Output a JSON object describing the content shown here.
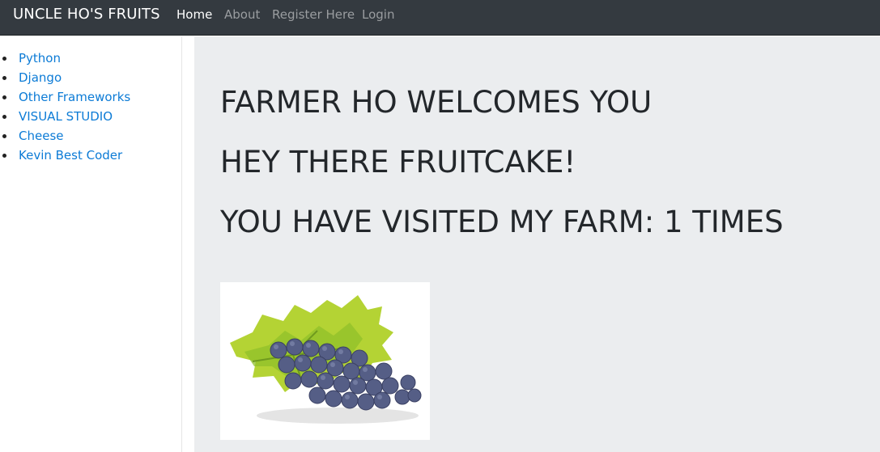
{
  "navbar": {
    "brand": "UNCLE HO'S FRUITS",
    "links": [
      {
        "label": "Home",
        "active": true
      },
      {
        "label": "About",
        "active": false
      },
      {
        "label": "Register Here",
        "active": false
      },
      {
        "label": "Login",
        "active": false
      }
    ]
  },
  "sidebar": {
    "items": [
      {
        "label": "Python"
      },
      {
        "label": "Django"
      },
      {
        "label": "Other Frameworks"
      },
      {
        "label": "VISUAL STUDIO"
      },
      {
        "label": "Cheese"
      },
      {
        "label": "Kevin Best Coder"
      }
    ]
  },
  "main": {
    "headings": [
      "FARMER HO WELCOMES YOU",
      "HEY THERE FRUITCAKE!",
      "YOU HAVE VISITED MY FARM: 1 TIMES"
    ],
    "image": {
      "subject": "grapes-image"
    }
  },
  "colors": {
    "navbar_bg": "#343a40",
    "link": "#0c7bd6",
    "main_bg": "#ebedef",
    "heading": "#23272b"
  }
}
